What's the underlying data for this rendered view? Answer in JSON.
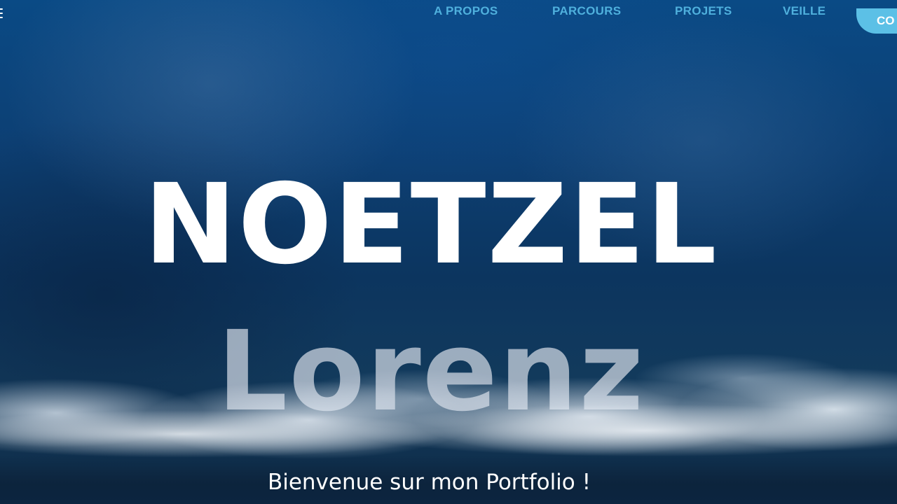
{
  "nav": {
    "items": [
      {
        "label": "A PROPOS"
      },
      {
        "label": "PARCOURS"
      },
      {
        "label": "PROJETS"
      },
      {
        "label": "VEILLE"
      }
    ],
    "contact_label": "CO",
    "menu_icon": "hamburger-icon"
  },
  "hero": {
    "last_name": "NOETZEL",
    "first_name": "Lorenz",
    "welcome": "Bienvenue sur mon Portfolio !"
  },
  "colors": {
    "nav_link": "#4fb0dd",
    "contact_button": "#5cc0e6",
    "background": "#0d3f73"
  }
}
